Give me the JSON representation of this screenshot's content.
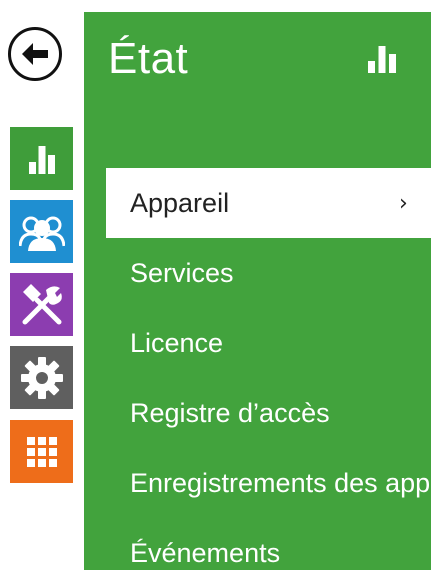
{
  "panel": {
    "title": "État",
    "icon": "bar-chart-icon"
  },
  "rail": {
    "back": {
      "icon": "back-arrow-icon"
    },
    "items": [
      {
        "key": "status",
        "icon": "bar-chart-icon",
        "color": "#3f9d3a"
      },
      {
        "key": "directory",
        "icon": "users-icon",
        "color": "#1f8fd1"
      },
      {
        "key": "hardware",
        "icon": "tools-icon",
        "color": "#8c3db0"
      },
      {
        "key": "system",
        "icon": "gear-icon",
        "color": "#5f5f5f"
      },
      {
        "key": "apps",
        "icon": "grid-icon",
        "color": "#ee6d1a"
      }
    ]
  },
  "menu": {
    "items": [
      {
        "label": "Appareil",
        "active": true,
        "chevron": "›"
      },
      {
        "label": "Services"
      },
      {
        "label": "Licence"
      },
      {
        "label": "Registre d’accès"
      },
      {
        "label": "Enregistrements des appels"
      },
      {
        "label": "Événements"
      }
    ]
  }
}
